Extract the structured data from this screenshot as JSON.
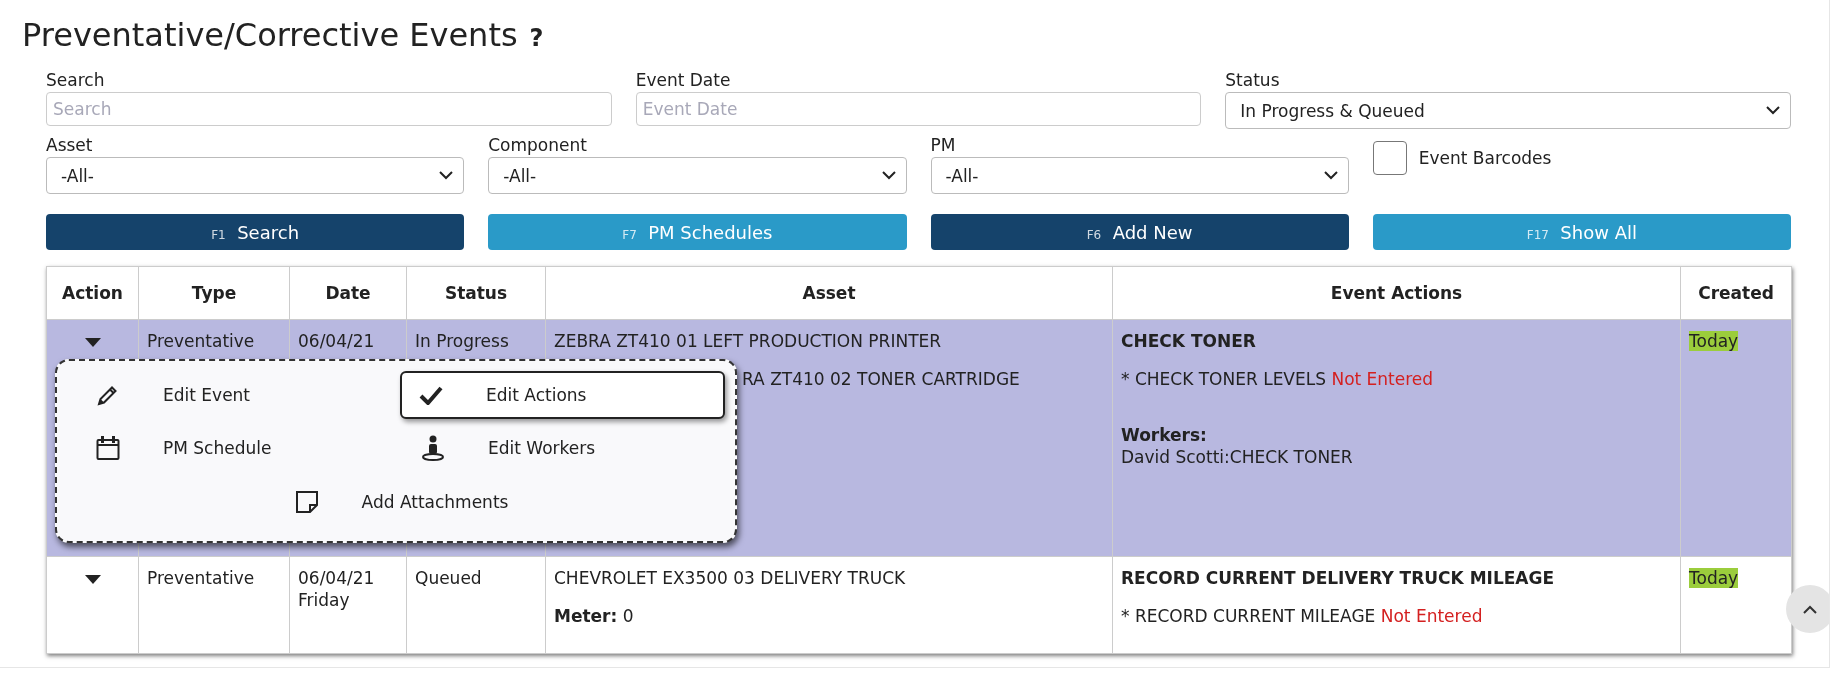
{
  "page": {
    "title": "Preventative/Corrective Events",
    "help": "?"
  },
  "filters_top": [
    {
      "label": "Search",
      "kind": "text",
      "placeholder": "Search"
    },
    {
      "label": "Event Date",
      "kind": "text",
      "placeholder": "Event Date"
    },
    {
      "label": "Status",
      "kind": "select",
      "value": "In Progress & Queued"
    }
  ],
  "filters_bottom": [
    {
      "label": "Asset",
      "kind": "select",
      "value": "-All-"
    },
    {
      "label": "Component",
      "kind": "select",
      "value": "-All-"
    },
    {
      "label": "PM",
      "kind": "select",
      "value": "-All-"
    }
  ],
  "barcodes_checkbox": {
    "label": "Event Barcodes",
    "checked": false
  },
  "buttons": [
    {
      "key": "F1",
      "label": "Search",
      "kind": "primary"
    },
    {
      "key": "F7",
      "label": "PM Schedules",
      "kind": "secondary"
    },
    {
      "key": "F6",
      "label": "Add New",
      "kind": "primary"
    },
    {
      "key": "F17",
      "label": "Show All",
      "kind": "secondary"
    }
  ],
  "table": {
    "columns": [
      "Action",
      "Type",
      "Date",
      "Status",
      "Asset",
      "Event Actions",
      "Created"
    ],
    "rows": [
      {
        "selected": true,
        "type": "Preventative",
        "date": "06/04/21",
        "status": "In Progress",
        "asset": "ZEBRA ZT410 01 LEFT PRODUCTION PRINTER",
        "details": [
          {
            "text": "RA ZT410 02 TONER CARTRIDGE",
            "covered_start": true
          }
        ],
        "action_title": "CHECK TONER",
        "action_items": [
          {
            "text": "* CHECK TONER LEVELS",
            "state": "Not Entered"
          }
        ],
        "workers_heading": "Workers:",
        "workers": [
          "David Scotti:CHECK TONER"
        ],
        "created": "Today"
      },
      {
        "selected": false,
        "type": "Preventative",
        "date": "06/04/21",
        "weekday": "Friday",
        "status": "Queued",
        "asset": "CHEVROLET EX3500 03 DELIVERY TRUCK",
        "details": [
          {
            "text": "**Meter:** 0"
          }
        ],
        "action_title": "RECORD CURRENT DELIVERY TRUCK MILEAGE",
        "action_items": [
          {
            "text": "* RECORD CURRENT MILEAGE",
            "state": "Not Entered"
          }
        ],
        "created": "Today"
      }
    ]
  },
  "context_menu": {
    "items": [
      {
        "label": "Edit Event",
        "kind": "pencil",
        "selected": false
      },
      {
        "label": "Edit Actions",
        "kind": "check",
        "selected": true
      },
      {
        "label": "PM Schedule",
        "kind": "calendar",
        "selected": false
      },
      {
        "label": "Edit Workers",
        "kind": "worker",
        "selected": false
      },
      {
        "label": "Add Attachments",
        "kind": "note",
        "selected": false
      }
    ]
  }
}
